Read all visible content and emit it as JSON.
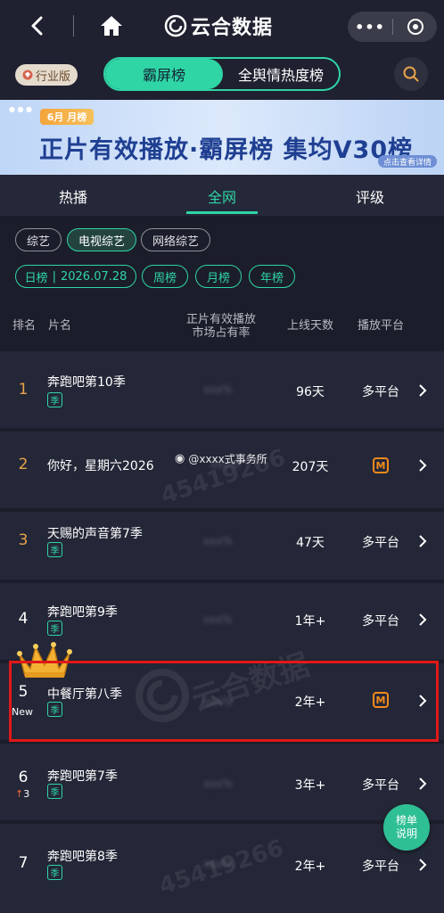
{
  "nav": {
    "brand": "云合数据",
    "more": "•••"
  },
  "toolbar": {
    "industry_badge": "行业版",
    "seg_active": "霸屏榜",
    "seg_inactive": "全舆情热度榜"
  },
  "banner": {
    "month_tag": "6月 月榜",
    "title": "正片有效播放·霸屏榜 集均V30榜",
    "link": "点击查看详情"
  },
  "tabs": [
    {
      "label": "热播",
      "active": false
    },
    {
      "label": "全网",
      "active": true
    },
    {
      "label": "评级",
      "active": false
    }
  ],
  "genre_chips": [
    {
      "label": "综艺",
      "selected": false
    },
    {
      "label": "电视综艺",
      "selected": true
    },
    {
      "label": "网络综艺",
      "selected": false
    }
  ],
  "period": {
    "date_prefix": "日榜",
    "date_sep": "|",
    "date": "2026.07.28",
    "weekly": "周榜",
    "monthly": "月榜",
    "yearly": "年榜"
  },
  "table_header": {
    "rank": "排名",
    "title": "片名",
    "share_line1": "正片有效播放",
    "share_line2": "市场占有率",
    "days": "上线天数",
    "platform": "播放平台"
  },
  "rows": [
    {
      "rank": "1",
      "title": "奔跑吧第10季",
      "season_tag": "季",
      "share": "xxx%",
      "days": "96天",
      "platform": "多平台"
    },
    {
      "rank": "2",
      "title": "你好，星期六2026",
      "share": "xxx%",
      "days": "207天",
      "platform_icon": "mango-tv-icon"
    },
    {
      "rank": "3",
      "title": "天赐的声音第7季",
      "season_tag": "季",
      "share": "xxx%",
      "days": "47天",
      "platform": "多平台"
    },
    {
      "rank": "4",
      "title": "奔跑吧第9季",
      "season_tag": "季",
      "share": "xxx%",
      "days": "1年+",
      "platform": "多平台"
    },
    {
      "rank": "5",
      "badge": "New",
      "title": "中餐厅第八季",
      "season_tag": "季",
      "share": "xxx%",
      "days": "2年+",
      "platform_icon": "mango-tv-icon"
    },
    {
      "rank": "6",
      "change": "3",
      "title": "奔跑吧第7季",
      "season_tag": "季",
      "share": "xxx%",
      "days": "3年+",
      "platform": "多平台"
    },
    {
      "rank": "7",
      "title": "奔跑吧第8季",
      "season_tag": "季",
      "share": "xxx%",
      "days": "2年+",
      "platform": "多平台"
    }
  ],
  "weibo_tag": "@xxxx式事务所",
  "watermarks": {
    "number": "45419266",
    "logo_text": "云合数据"
  },
  "fab": {
    "line1": "榜单",
    "line2": "说明"
  },
  "colors": {
    "accent": "#2fd5a5",
    "gold_rank": "#e9a34a",
    "highlight": "#e01818",
    "mango": "#f28a1c"
  }
}
